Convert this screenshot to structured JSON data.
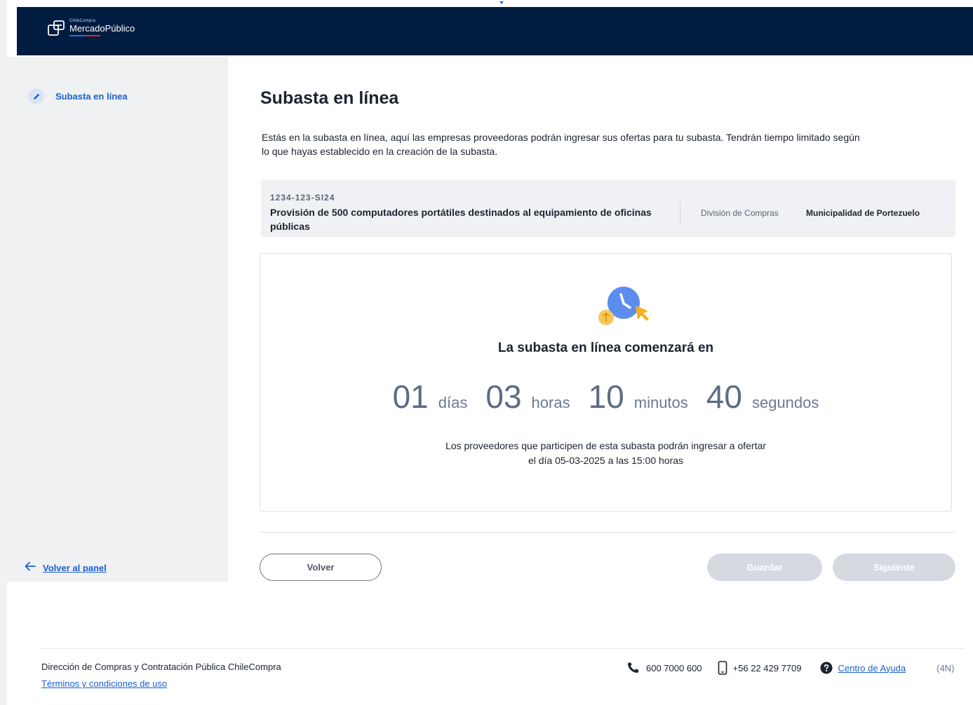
{
  "header": {
    "logo_small": "ChileCompra",
    "logo_big": "MercadoPúblico",
    "brand_colors": [
      "#2f6ce0",
      "#e1262d"
    ]
  },
  "sidebar": {
    "items": [
      {
        "label": "Subasta en  línea",
        "icon": "pencil-icon"
      }
    ],
    "back_link": "Volver al panel"
  },
  "main": {
    "title": "Subasta en línea",
    "intro": "Estás en la subasta en línea, aquí las empresas proveedoras podrán ingresar sus ofertas para tu subasta. Tendrán tiempo limitado según lo que hayas establecido en la creación de la subasta.",
    "info": {
      "code": "1234-123-SI24",
      "title": "Provisión de 500 computadores portátiles destinados al equipamiento de oficinas públicas",
      "department": "División de Compras",
      "municipality": "Municipalidad de Portezuelo"
    },
    "countdown": {
      "heading": "La subasta en línea comenzará en",
      "days": "01",
      "days_label": "días",
      "hours": "03",
      "hours_label": "horas",
      "minutes": "10",
      "minutes_label": "minutos",
      "seconds": "40",
      "seconds_label": "segundos",
      "note_line1": "Los proveedores que participen de esta subasta podrán ingresar a ofertar",
      "note_line2": "el día 05-03-2025 a las 15:00 horas"
    },
    "buttons": {
      "back": "Volver",
      "save": "Guardar",
      "next": "Siguiente"
    }
  },
  "footer": {
    "org": "Dirección de Compras y Contratación Pública ChileCompra",
    "terms": "Términos y condiciones de uso",
    "phone": "600 7000 600",
    "mobile": "+56 22 429 7709",
    "help": "Centro de Ayuda",
    "code": "(4N)"
  },
  "colors": {
    "header_bg": "#001c41",
    "link": "#1a5fd1",
    "disabled_button": "#d6dae0",
    "accent_yellow": "#f5b01a",
    "clock_blue": "#5b8def"
  }
}
